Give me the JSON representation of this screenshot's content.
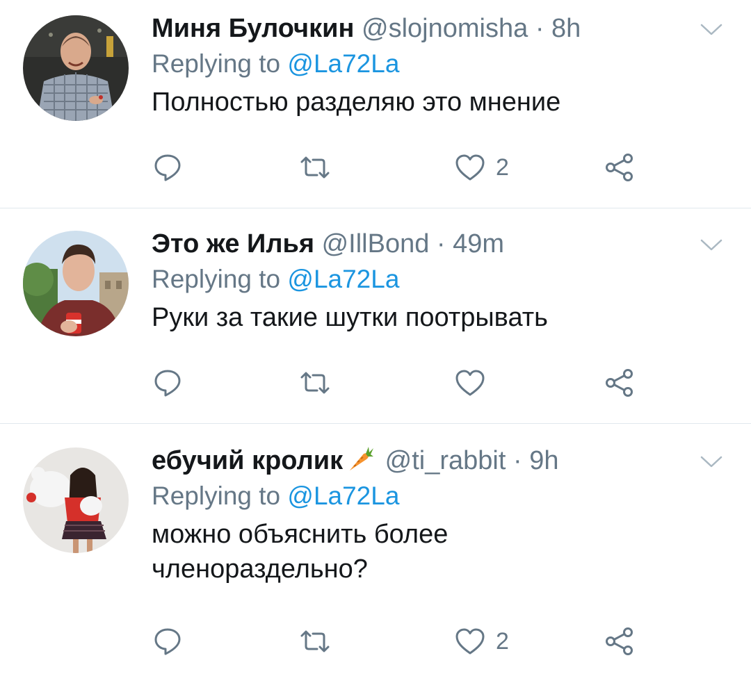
{
  "colors": {
    "text": "#14171a",
    "secondary": "#657786",
    "link": "#1b95e0",
    "divider": "#e1e8ed"
  },
  "tweets": [
    {
      "name": "Миня Булочкин",
      "handle": "@slojnomisha",
      "separator": "·",
      "time": "8h",
      "replying_prefix": "Replying to",
      "replying_to": "@La72La",
      "text_lines": [
        "Полностью разделяю это мнение"
      ],
      "like_count": "2",
      "icons": [
        "reply-icon",
        "retweet-icon",
        "heart-icon",
        "share-icon",
        "chevron-down-icon"
      ]
    },
    {
      "name": "Это же Илья",
      "handle": "@IllBond",
      "separator": "·",
      "time": "49m",
      "replying_prefix": "Replying to",
      "replying_to": "@La72La",
      "text_lines": [
        "Руки за такие шутки поотрывать"
      ],
      "like_count": "",
      "icons": [
        "reply-icon",
        "retweet-icon",
        "heart-icon",
        "share-icon",
        "chevron-down-icon"
      ]
    },
    {
      "name": "ебучий кролик",
      "name_emoji": "carrot-icon",
      "handle": "@ti_rabbit",
      "separator": "·",
      "time": "9h",
      "replying_prefix": "Replying to",
      "replying_to": "@La72La",
      "text_lines": [
        "можно объяснить более",
        "членораздельно?"
      ],
      "like_count": "2",
      "icons": [
        "reply-icon",
        "retweet-icon",
        "heart-icon",
        "share-icon",
        "chevron-down-icon"
      ]
    }
  ]
}
